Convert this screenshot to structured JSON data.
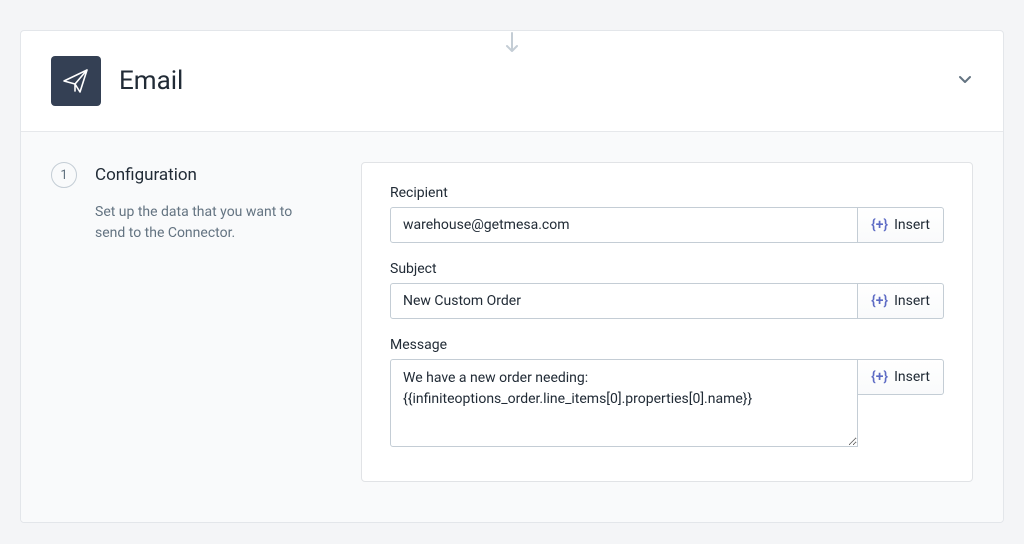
{
  "step": {
    "iconName": "paper-plane-icon",
    "title": "Email",
    "number": "1",
    "sectionTitle": "Configuration",
    "description": "Set up the data that you want to send to the Connector."
  },
  "fields": {
    "recipient": {
      "label": "Recipient",
      "value": "warehouse@getmesa.com"
    },
    "subject": {
      "label": "Subject",
      "value": "New Custom Order"
    },
    "message": {
      "label": "Message",
      "value": "We have a new order needing:\n{{infiniteoptions_order.line_items[0].properties[0].name}}"
    }
  },
  "buttons": {
    "insertLabel": "Insert",
    "insertIcon": "{+}"
  }
}
